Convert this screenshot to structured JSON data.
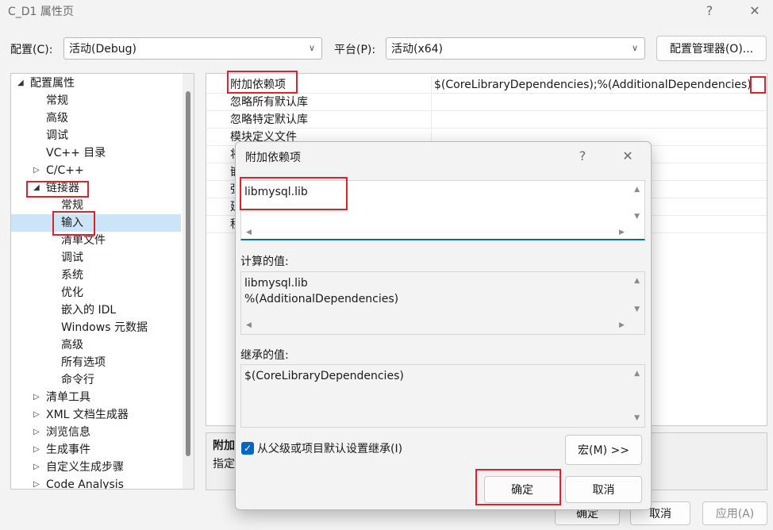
{
  "window": {
    "title": "C_D1 属性页",
    "help_glyph": "?",
    "close_glyph": "✕"
  },
  "toolbar": {
    "config_label": "配置(C):",
    "config_value": "活动(Debug)",
    "platform_label": "平台(P):",
    "platform_value": "活动(x64)",
    "config_manager_label": "配置管理器(O)..."
  },
  "tree": {
    "items": [
      {
        "label": "配置属性",
        "expander": "◢"
      },
      {
        "label": "常规"
      },
      {
        "label": "高级"
      },
      {
        "label": "调试"
      },
      {
        "label": "VC++ 目录"
      },
      {
        "label": "C/C++",
        "expander": "▷"
      },
      {
        "label": "链接器",
        "expander": "◢"
      },
      {
        "label": "常规"
      },
      {
        "label": "输入"
      },
      {
        "label": "清单文件"
      },
      {
        "label": "调试"
      },
      {
        "label": "系统"
      },
      {
        "label": "优化"
      },
      {
        "label": "嵌入的 IDL"
      },
      {
        "label": "Windows 元数据"
      },
      {
        "label": "高级"
      },
      {
        "label": "所有选项"
      },
      {
        "label": "命令行"
      },
      {
        "label": "清单工具",
        "expander": "▷"
      },
      {
        "label": "XML 文档生成器",
        "expander": "▷"
      },
      {
        "label": "浏览信息",
        "expander": "▷"
      },
      {
        "label": "生成事件",
        "expander": "▷"
      },
      {
        "label": "自定义生成步骤",
        "expander": "▷"
      },
      {
        "label": "Code Analysis",
        "expander": "▷"
      }
    ]
  },
  "properties": {
    "rows": [
      {
        "name": "附加依赖项",
        "value": "$(CoreLibraryDependencies);%(AdditionalDependencies)"
      },
      {
        "name": "忽略所有默认库",
        "value": ""
      },
      {
        "name": "忽略特定默认库",
        "value": ""
      },
      {
        "name": "模块定义文件",
        "value": ""
      },
      {
        "name": "将",
        "value": ""
      },
      {
        "name": "嵌",
        "value": ""
      },
      {
        "name": "强",
        "value": ""
      },
      {
        "name": "延",
        "value": ""
      },
      {
        "name": "程",
        "value": ""
      }
    ],
    "desc_title": "附加",
    "desc_text": "指定"
  },
  "footer": {
    "ok_label": "确定",
    "cancel_label": "取消",
    "apply_label": "应用(A)"
  },
  "dialog": {
    "title": "附加依赖项",
    "help_glyph": "?",
    "close_glyph": "✕",
    "input_text": "libmysql.lib",
    "computed_label": "计算的值:",
    "computed_lines": "libmysql.lib\n%(AdditionalDependencies)",
    "inherited_label": "继承的值:",
    "inherited_text": "$(CoreLibraryDependencies)",
    "inherit_checkbox_label": "从父级或项目默认设置继承(I)",
    "inherit_checked": true,
    "macro_button_label": "宏(M) >>",
    "ok_label": "确定",
    "cancel_label": "取消"
  },
  "colors": {
    "highlight_box": "#e0202a",
    "accent": "#0067c0",
    "selection": "#cce4f7"
  }
}
